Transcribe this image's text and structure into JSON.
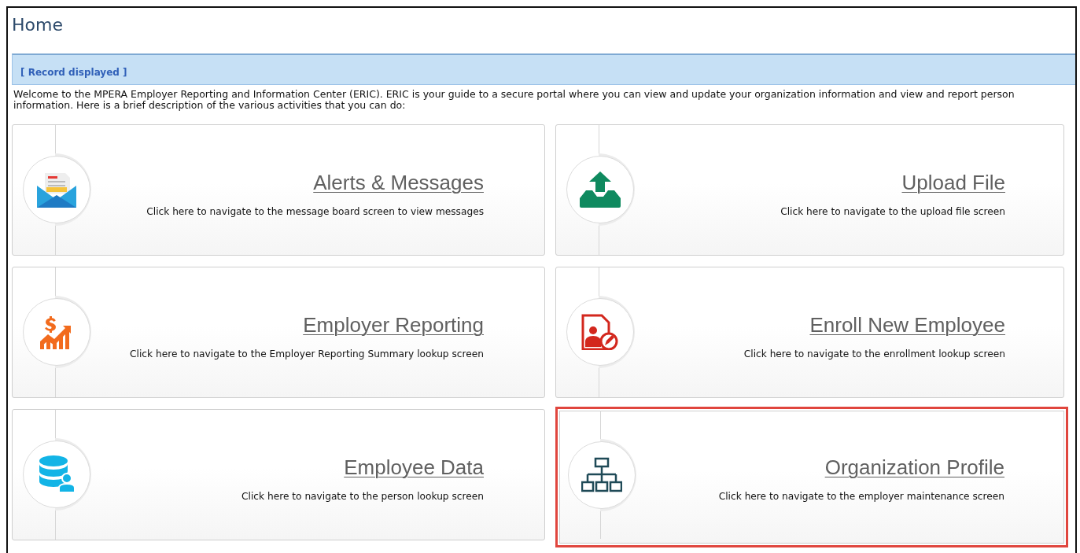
{
  "page": {
    "title": "Home"
  },
  "banner": {
    "text": "[ Record displayed ]"
  },
  "intro": "Welcome to the MPERA Employer Reporting and Information Center (ERIC). ERIC is your guide to a secure portal where you can view and update your organization information and view and report person information. Here is a brief description of the various activities that you can do:",
  "cards": [
    {
      "kind": "envelope",
      "title": "Alerts & Messages",
      "description": "Click here to navigate to the message board screen to view messages",
      "highlighted": false
    },
    {
      "kind": "upload",
      "title": "Upload File",
      "description": "Click here to navigate to the upload file screen",
      "highlighted": false
    },
    {
      "kind": "chart",
      "title": "Employer Reporting",
      "description": "Click here to navigate to the Employer Reporting Summary lookup screen",
      "highlighted": false
    },
    {
      "kind": "enroll",
      "title": "Enroll New Employee",
      "description": "Click here to navigate to the enrollment lookup screen",
      "highlighted": false
    },
    {
      "kind": "database",
      "title": "Employee Data",
      "description": "Click here to navigate to the person lookup screen",
      "highlighted": false
    },
    {
      "kind": "org",
      "title": "Organization Profile",
      "description": "Click here to navigate to the employer maintenance screen",
      "highlighted": true
    }
  ]
}
